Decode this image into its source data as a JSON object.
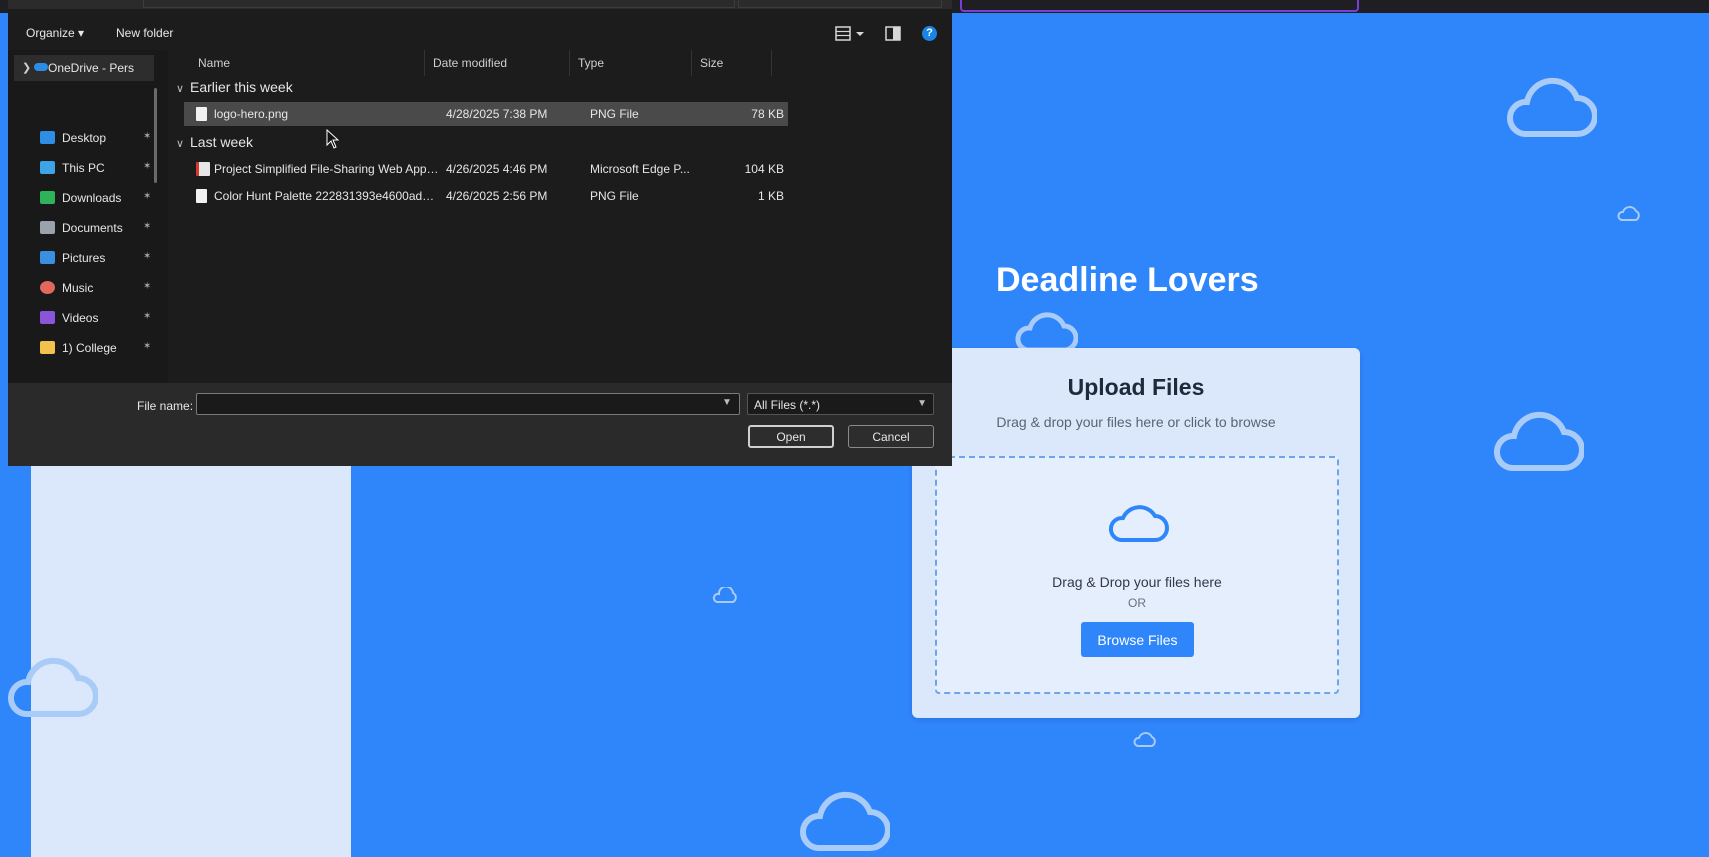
{
  "hero": {
    "title": "Deadline Lovers"
  },
  "upload_card": {
    "title": "Upload Files",
    "subtitle": "Drag & drop your files here or click to browse",
    "drop_text": "Drag & Drop your files here",
    "or_text": "OR",
    "browse_label": "Browse Files"
  },
  "dialog": {
    "toolbar": {
      "organize_label": "Organize ▾",
      "new_folder_label": "New folder"
    },
    "nav": {
      "top_item": "OneDrive - Pers",
      "items": [
        {
          "label": "Desktop",
          "icon": "desktop-icon",
          "color": "#2f8de4"
        },
        {
          "label": "This PC",
          "icon": "computer-icon",
          "color": "#3fa3e8"
        },
        {
          "label": "Downloads",
          "icon": "download-icon",
          "color": "#2fb35a"
        },
        {
          "label": "Documents",
          "icon": "document-icon",
          "color": "#9aa3ad"
        },
        {
          "label": "Pictures",
          "icon": "picture-icon",
          "color": "#3b8fe0"
        },
        {
          "label": "Music",
          "icon": "music-icon",
          "color": "#e0685c"
        },
        {
          "label": "Videos",
          "icon": "video-icon",
          "color": "#8a55d8"
        },
        {
          "label": "1) College",
          "icon": "folder-icon",
          "color": "#f2c14e"
        }
      ]
    },
    "columns": {
      "name": "Name",
      "date": "Date modified",
      "type": "Type",
      "size": "Size"
    },
    "groups": [
      {
        "label": "Earlier this week",
        "files": [
          {
            "name": "logo-hero.png",
            "date": "4/28/2025 7:38 PM",
            "type": "PNG File",
            "size": "78 KB",
            "selected": true
          }
        ]
      },
      {
        "label": "Last week",
        "files": [
          {
            "name": "Project Simplified File-Sharing Web Appli...",
            "date": "4/26/2025 4:46 PM",
            "type": "Microsoft Edge P...",
            "size": "104 KB",
            "selected": false
          },
          {
            "name": "Color Hunt Palette 222831393e4600adb5e...",
            "date": "4/26/2025 2:56 PM",
            "type": "PNG File",
            "size": "1 KB",
            "selected": false
          }
        ]
      }
    ],
    "file_name_label": "File name:",
    "file_name_value": "",
    "file_type_value": "All Files (*.*)",
    "open_label": "Open",
    "cancel_label": "Cancel"
  },
  "colors": {
    "background": "#2f86fb",
    "card": "#dbe8fb",
    "accent": "#2f86fb",
    "dialog": "#1c1c1c"
  }
}
